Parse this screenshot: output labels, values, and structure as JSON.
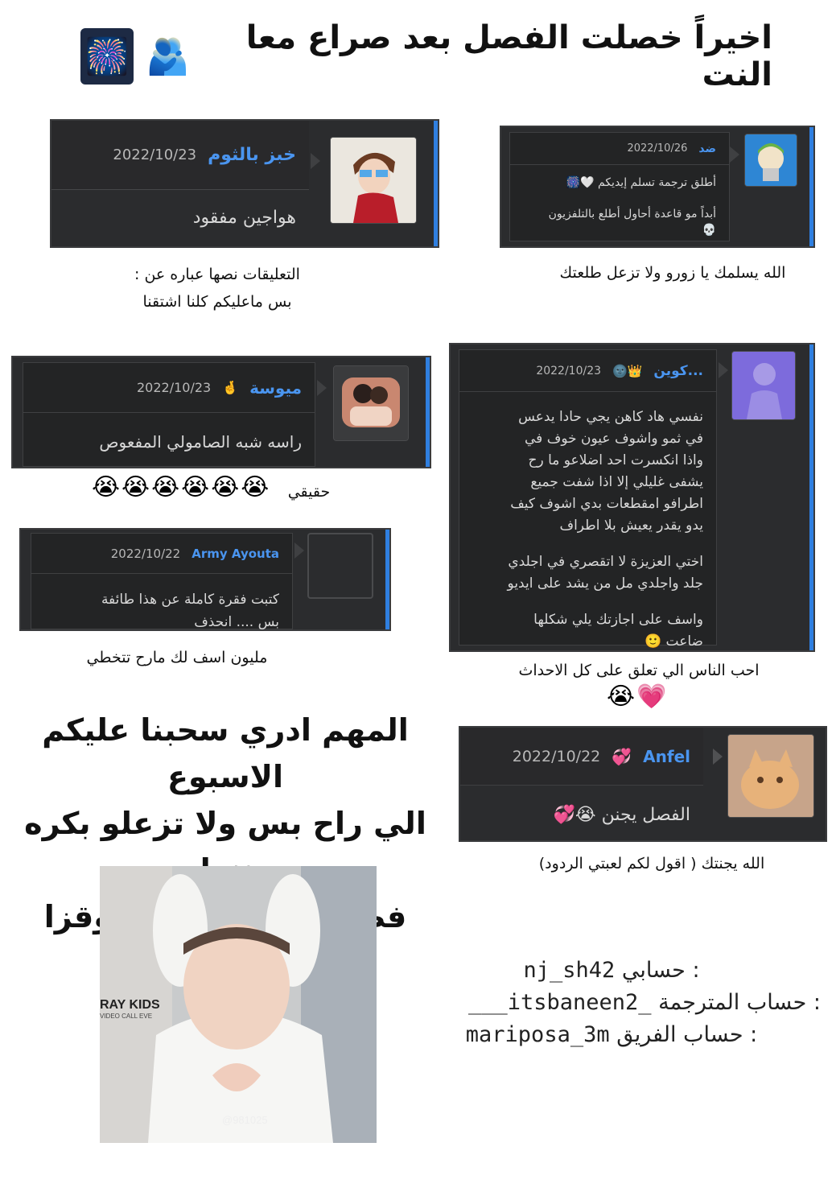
{
  "title": {
    "text": "اخيراً خصلت الفصل بعد صراع معا النت",
    "emoji_fireworks": "🎆",
    "emoji_hug": "🫂"
  },
  "cards": [
    {
      "id": "zoro",
      "name": "ضد",
      "date": "2022/10/26",
      "lines": [
        "أطلق ترجمة تسلم إيديكم 🤍🎆",
        "أبداً مو قاعدة أحاول أطلع بالتلفزيون",
        "💀"
      ]
    },
    {
      "id": "bread",
      "name": "خبز بالثوم",
      "date": "2022/10/23",
      "lines": [
        "هواجين مفقود"
      ]
    },
    {
      "id": "mayousa",
      "name": "ميوسة",
      "emoji": "🤞",
      "date": "2022/10/23",
      "lines": [
        "راسه شبه الصامولي المفعوص"
      ]
    },
    {
      "id": "army",
      "name": "Army Ayouta",
      "date": "2022/10/22",
      "lines": [
        "كتبت فقرة كاملة عن هذا طائفة",
        "بس .... انحذف"
      ]
    },
    {
      "id": "kwin",
      "name": "كوين...",
      "emoji": "🌚👑",
      "date": "2022/10/23",
      "lines": [
        "نفسي هاد كاهن يجي حادا يدعس",
        "في ثمو واشوف عيون خوف في",
        "واذا انكسرت احد اضلاعو ما رح",
        "يشفى غليلي إلا اذا شفت جميع",
        "اطرافو امقطعات بدي اشوف كيف",
        "يدو يقدر يعيش بلا اطراف",
        "اختي العزيزة لا اتقصري في اجلدي",
        "جلد واجلدي مل من يشد على ايديو",
        "واسف على اجازتك يلي شكلها",
        "ضاعت 🙂"
      ]
    },
    {
      "id": "anfel",
      "name": "Anfel",
      "emoji": "💞",
      "date": "2022/10/22",
      "lines": [
        "الفصل يجنن 😭💞"
      ]
    }
  ],
  "notes": {
    "zoro": "الله يسلمك يا زورو ولا تزعل طلعتك",
    "bread_1": "التعليقات نصها عباره عن :",
    "bread_2": "بس ماعليكم كلنا اشتقنا",
    "mayousa": "حقيقي",
    "mayousa_emojis": "😭😭😭😭😭😭",
    "army": "مليون اسف لك مارح تتخطي",
    "kwin": "احب الناس الي تعلق على كل الاحداث",
    "kwin_emojis": "😭💗",
    "anfel": "الله يجنتك ( اقول لكم لعبتي الردود)"
  },
  "big_message": [
    "المهم ادري سحبنا عليكم الاسبوع",
    "الي راح بس ولا تزعلو بكره بننزل",
    "فصل ثاني نعوضكم وقزا"
  ],
  "photo": {
    "watermark": "@981025",
    "caption_logo": "RAY KIDS",
    "caption_sub": "VIDEO CALL EVE"
  },
  "accounts": [
    {
      "label": "حسابي :",
      "handle": "nj_sh42"
    },
    {
      "label": "حساب المترجمة :",
      "handle": "___itsbaneen2_"
    },
    {
      "label": "حساب الفريق :",
      "handle": "mariposa_3m"
    }
  ]
}
